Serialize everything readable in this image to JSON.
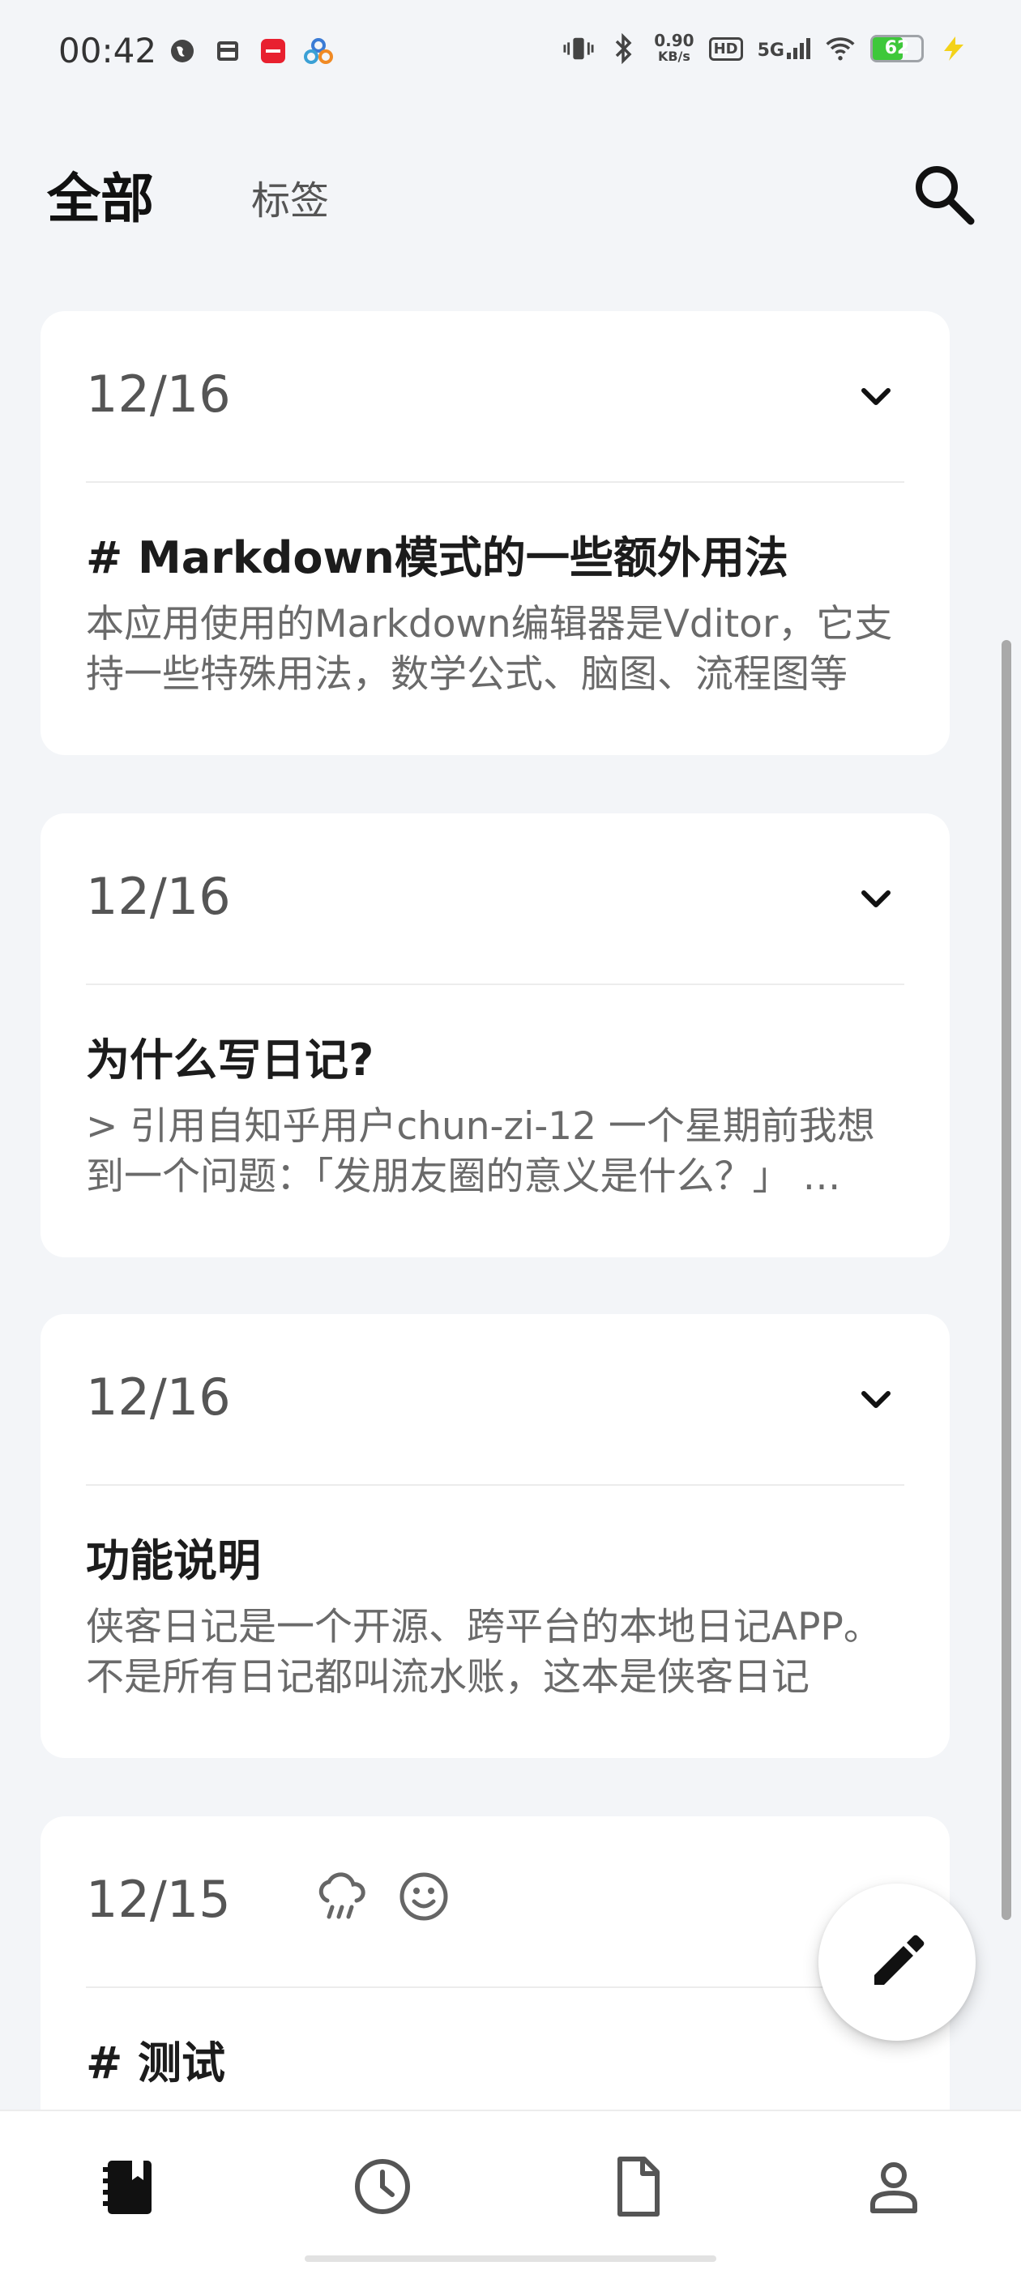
{
  "status_bar": {
    "time": "00:42",
    "net_speed_value": "0.90",
    "net_speed_unit": "KB/s",
    "hd_label": "HD",
    "network_label": "5G",
    "battery_level": "62",
    "battery_fraction": 0.62,
    "left_icons": [
      "globe-icon",
      "inbox-icon",
      "app-badge-icon",
      "share-icon"
    ]
  },
  "header": {
    "tab_all": "全部",
    "tab_tags": "标签"
  },
  "entries": [
    {
      "date": "12/16",
      "title": "# Markdown模式的一些额外用法",
      "snippet": "本应用使用的Markdown编辑器是Vditor，它支持一些特殊用法，数学公式、脑图、流程图等"
    },
    {
      "date": "12/16",
      "title": "为什么写日记?",
      "snippet": "> 引用自知乎用户chun-zi-12 一个星期前我想到一个问题：「发朋友圈的意义是什么？」 …"
    },
    {
      "date": "12/16",
      "title": "功能说明",
      "snippet": "侠客日记是一个开源、跨平台的本地日记APP。 不是所有日记都叫流水账，这本是侠客日记"
    },
    {
      "date": "12/15",
      "title": "# 测试",
      "snippet": "",
      "weather_icon": "rain-cloud-icon",
      "mood_icon": "smile-icon"
    }
  ],
  "bottom_nav": [
    "diary-icon",
    "clock-icon",
    "document-icon",
    "profile-icon"
  ],
  "colors": {
    "background": "#f3f5f8",
    "card": "#ffffff",
    "battery": "#3ec83a"
  }
}
